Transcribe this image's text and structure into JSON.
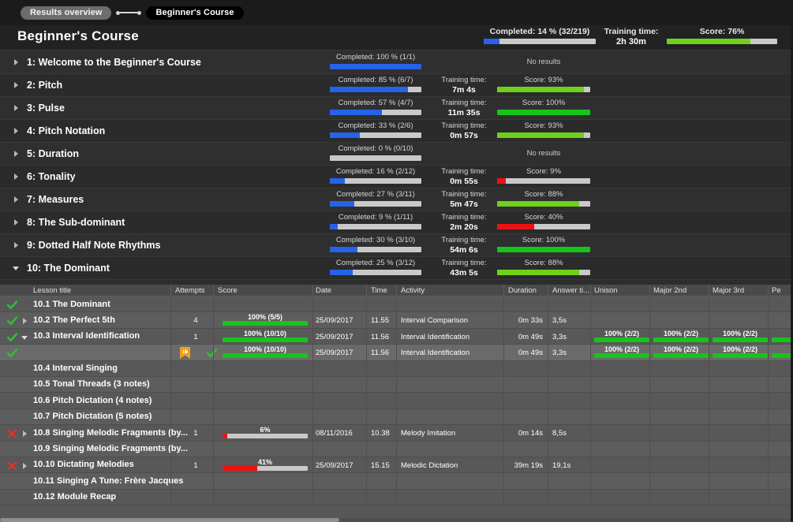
{
  "breadcrumb": {
    "previous": "Results overview",
    "current": "Beginner's Course"
  },
  "header": {
    "title": "Beginner's Course",
    "completed_label": "Completed: 14 %  (32/219)",
    "completed_pct": 14,
    "training_time_label": "Training time:",
    "training_time_value": "2h 30m",
    "score_label": "Score: 76%",
    "score_pct": 76
  },
  "colors": {
    "progress_blue": "#2563e8",
    "score_green": "#17c419",
    "score_lightgreen": "#6fd01a",
    "score_red": "#ee1111",
    "track_grey": "#c9c9c9",
    "bookmark_orange": "#f0a020",
    "tick_green": "#2fc22f",
    "cross_red": "#e03030"
  },
  "modules": [
    {
      "name": "1: Welcome to the Beginner's Course",
      "expanded": false,
      "completed_label": "Completed: 100 %  (1/1)",
      "completed_pct": 100,
      "training_time_label": "",
      "training_time_value": "",
      "score_label": "No results",
      "score_pct": null
    },
    {
      "name": "2: Pitch",
      "expanded": false,
      "completed_label": "Completed: 85 %  (6/7)",
      "completed_pct": 85,
      "training_time_label": "Training time:",
      "training_time_value": "7m 4s",
      "score_label": "Score: 93%",
      "score_pct": 93
    },
    {
      "name": "3: Pulse",
      "expanded": false,
      "completed_label": "Completed: 57 %  (4/7)",
      "completed_pct": 57,
      "training_time_label": "Training time:",
      "training_time_value": "11m 35s",
      "score_label": "Score: 100%",
      "score_pct": 100
    },
    {
      "name": "4: Pitch Notation",
      "expanded": false,
      "completed_label": "Completed: 33 %  (2/6)",
      "completed_pct": 33,
      "training_time_label": "Training time:",
      "training_time_value": "0m 57s",
      "score_label": "Score: 93%",
      "score_pct": 93
    },
    {
      "name": "5: Duration",
      "expanded": false,
      "completed_label": "Completed: 0 %  (0/10)",
      "completed_pct": 0,
      "training_time_label": "",
      "training_time_value": "",
      "score_label": "No results",
      "score_pct": null
    },
    {
      "name": "6: Tonality",
      "expanded": false,
      "completed_label": "Completed: 16 %  (2/12)",
      "completed_pct": 16,
      "training_time_label": "Training time:",
      "training_time_value": "0m 55s",
      "score_label": "Score: 9%",
      "score_pct": 9
    },
    {
      "name": "7: Measures",
      "expanded": false,
      "completed_label": "Completed: 27 %  (3/11)",
      "completed_pct": 27,
      "training_time_label": "Training time:",
      "training_time_value": "5m 47s",
      "score_label": "Score: 88%",
      "score_pct": 88
    },
    {
      "name": "8: The Sub-dominant",
      "expanded": false,
      "completed_label": "Completed: 9 %  (1/11)",
      "completed_pct": 9,
      "training_time_label": "Training time:",
      "training_time_value": "2m 20s",
      "score_label": "Score: 40%",
      "score_pct": 40
    },
    {
      "name": "9: Dotted Half Note Rhythms",
      "expanded": false,
      "completed_label": "Completed: 30 %  (3/10)",
      "completed_pct": 30,
      "training_time_label": "Training time:",
      "training_time_value": "54m 6s",
      "score_label": "Score: 100%",
      "score_pct": 100
    },
    {
      "name": "10: The Dominant",
      "expanded": true,
      "completed_label": "Completed: 25 %  (3/12)",
      "completed_pct": 25,
      "training_time_label": "Training time:",
      "training_time_value": "43m 5s",
      "score_label": "Score: 88%",
      "score_pct": 88
    }
  ],
  "table": {
    "columns": [
      "Lesson title",
      "Attempts",
      "Score",
      "Date",
      "Time",
      "Activity",
      "Duration",
      "Answer ti...",
      "Unison",
      "Major 2nd",
      "Major 3rd",
      "Pe"
    ],
    "rows": [
      {
        "status": "pass",
        "expander": "none",
        "title": "10.1 The Dominant",
        "attempts": "",
        "score_label": "",
        "score_pct": null,
        "score_color": "",
        "date": "",
        "time": "",
        "activity": "",
        "duration": "",
        "answer_time": "",
        "intervals": [],
        "bookmark": false,
        "selected": false
      },
      {
        "status": "pass",
        "expander": "closed",
        "title": "10.2 The Perfect 5th",
        "attempts": "4",
        "score_label": "100%  (5/5)",
        "score_pct": 100,
        "score_color": "green",
        "date": "25/09/2017",
        "time": "11.55",
        "activity": "Interval Comparison",
        "duration": "0m 33s",
        "answer_time": "3,5s",
        "intervals": [],
        "bookmark": false,
        "selected": false
      },
      {
        "status": "pass",
        "expander": "open",
        "title": "10.3 Interval Identification",
        "attempts": "1",
        "score_label": "100%  (10/10)",
        "score_pct": 100,
        "score_color": "green",
        "date": "25/09/2017",
        "time": "11.56",
        "activity": "Interval Identification",
        "duration": "0m 49s",
        "answer_time": "3,3s",
        "intervals": [
          {
            "label": "100%  (2/2)",
            "pct": 100
          },
          {
            "label": "100%  (2/2)",
            "pct": 100
          },
          {
            "label": "100%  (2/2)",
            "pct": 100
          },
          {
            "label": "",
            "pct": 100
          }
        ],
        "bookmark": false,
        "selected": false
      },
      {
        "status": "pass",
        "expander": "none",
        "title": "",
        "attempts": "",
        "score_label": "100%  (10/10)",
        "score_pct": 100,
        "score_color": "green",
        "date": "25/09/2017",
        "time": "11.56",
        "activity": "Interval Identification",
        "duration": "0m 49s",
        "answer_time": "3,3s",
        "intervals": [
          {
            "label": "100%  (2/2)",
            "pct": 100
          },
          {
            "label": "100%  (2/2)",
            "pct": 100
          },
          {
            "label": "100%  (2/2)",
            "pct": 100
          },
          {
            "label": "",
            "pct": 100
          }
        ],
        "bookmark": true,
        "selected": true
      },
      {
        "status": "none",
        "expander": "none",
        "title": "10.4 Interval Singing",
        "attempts": "",
        "score_label": "",
        "score_pct": null,
        "score_color": "",
        "date": "",
        "time": "",
        "activity": "",
        "duration": "",
        "answer_time": "",
        "intervals": [],
        "bookmark": false,
        "selected": false
      },
      {
        "status": "none",
        "expander": "none",
        "title": "10.5 Tonal Threads (3 notes)",
        "attempts": "",
        "score_label": "",
        "score_pct": null,
        "score_color": "",
        "date": "",
        "time": "",
        "activity": "",
        "duration": "",
        "answer_time": "",
        "intervals": [],
        "bookmark": false,
        "selected": false
      },
      {
        "status": "none",
        "expander": "none",
        "title": "10.6 Pitch Dictation (4 notes)",
        "attempts": "",
        "score_label": "",
        "score_pct": null,
        "score_color": "",
        "date": "",
        "time": "",
        "activity": "",
        "duration": "",
        "answer_time": "",
        "intervals": [],
        "bookmark": false,
        "selected": false
      },
      {
        "status": "none",
        "expander": "none",
        "title": "10.7 Pitch Dictation (5 notes)",
        "attempts": "",
        "score_label": "",
        "score_pct": null,
        "score_color": "",
        "date": "",
        "time": "",
        "activity": "",
        "duration": "",
        "answer_time": "",
        "intervals": [],
        "bookmark": false,
        "selected": false
      },
      {
        "status": "fail",
        "expander": "closed",
        "title": "10.8 Singing Melodic Fragments (by...",
        "attempts": "1",
        "score_label": "6%",
        "score_pct": 6,
        "score_color": "red",
        "date": "08/11/2016",
        "time": "10.38",
        "activity": "Melody Imitation",
        "duration": "0m 14s",
        "answer_time": "8,5s",
        "intervals": [],
        "bookmark": false,
        "selected": false
      },
      {
        "status": "none",
        "expander": "none",
        "title": "10.9 Singing Melodic Fragments (by...",
        "attempts": "",
        "score_label": "",
        "score_pct": null,
        "score_color": "",
        "date": "",
        "time": "",
        "activity": "",
        "duration": "",
        "answer_time": "",
        "intervals": [],
        "bookmark": false,
        "selected": false
      },
      {
        "status": "fail",
        "expander": "closed",
        "title": "10.10 Dictating Melodies",
        "attempts": "1",
        "score_label": "41%",
        "score_pct": 41,
        "score_color": "red",
        "date": "25/09/2017",
        "time": "15.15",
        "activity": "Melodic Dictation",
        "duration": "39m 19s",
        "answer_time": "19,1s",
        "intervals": [],
        "bookmark": false,
        "selected": false
      },
      {
        "status": "none",
        "expander": "none",
        "title": "10.11 Singing A Tune: Frère Jacques",
        "attempts": "",
        "score_label": "",
        "score_pct": null,
        "score_color": "",
        "date": "",
        "time": "",
        "activity": "",
        "duration": "",
        "answer_time": "",
        "intervals": [],
        "bookmark": false,
        "selected": false
      },
      {
        "status": "none",
        "expander": "none",
        "title": "10.12 Module Recap",
        "attempts": "",
        "score_label": "",
        "score_pct": null,
        "score_color": "",
        "date": "",
        "time": "",
        "activity": "",
        "duration": "",
        "answer_time": "",
        "intervals": [],
        "bookmark": false,
        "selected": false
      }
    ]
  }
}
